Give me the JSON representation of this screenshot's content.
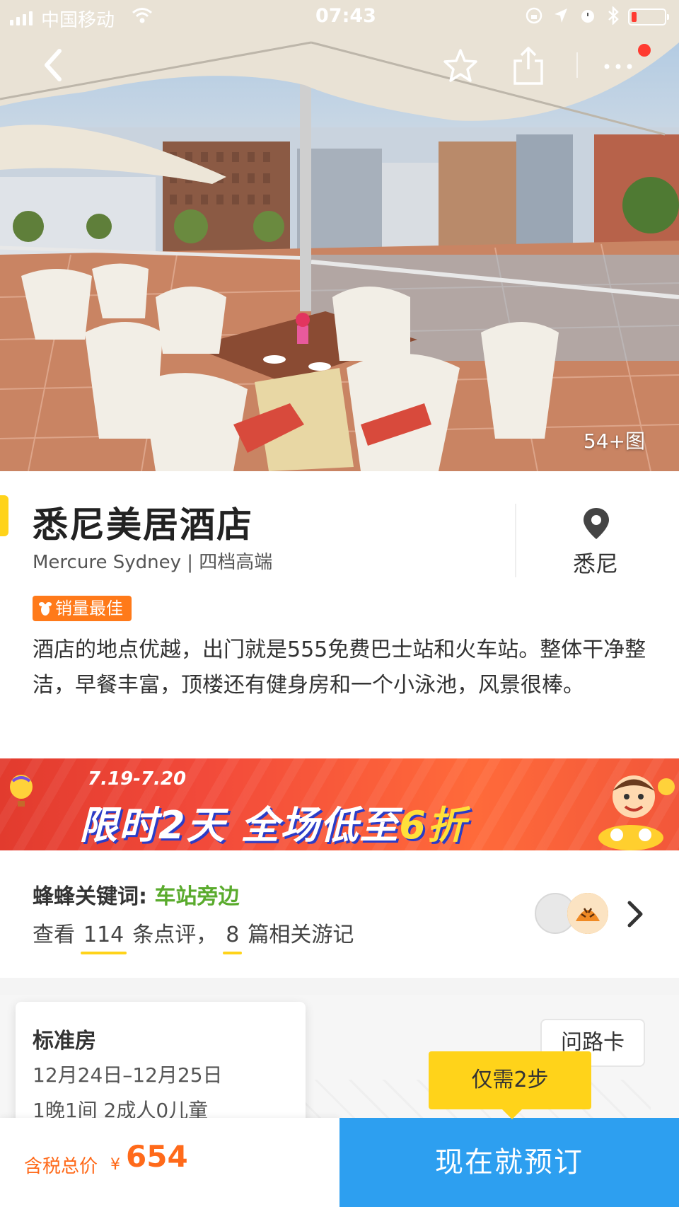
{
  "status_bar": {
    "carrier": "中国移动",
    "time": "07:43"
  },
  "nav": {
    "back_icon": "chevron-left-icon",
    "favorite_icon": "star-icon",
    "share_icon": "share-icon",
    "more_icon": "more-icon",
    "notification_dot_color": "#ff3b30"
  },
  "gallery": {
    "photo_count": "54+图"
  },
  "hotel": {
    "name": "悉尼美居酒店",
    "subtitle": "Mercure Sydney | 四档高端",
    "location": "悉尼",
    "badge": "销量最佳",
    "review": "酒店的地点优越，出门就是555免费巴士站和火车站。整体干净整洁，早餐丰富，顶楼还有健身房和一个小泳池，风景很棒。"
  },
  "promo": {
    "dates": "7.19-7.20",
    "headline_a": "限时2天 全场低至",
    "headline_b": "6折"
  },
  "keywords": {
    "label": "蜂蜂关键词:",
    "value": "车站旁边",
    "view": "查看",
    "review_count": "114",
    "reviews_suffix": "条点评，",
    "travelogue_count": "8",
    "travelogue_suffix": "篇相关游记"
  },
  "room": {
    "type": "标准房",
    "dates": "12月24日–12月25日",
    "guests": "1晚1间 2成人0儿童"
  },
  "route_card": "问路卡",
  "tooltip": "仅需2步",
  "bottom": {
    "price_label": "含税总价",
    "currency": "¥",
    "price": "654",
    "book_label": "现在就预订"
  },
  "colors": {
    "accent_yellow": "#ffd31a",
    "price_orange": "#ff6a1a",
    "book_blue": "#2d9ff0",
    "keyword_green": "#5aab2d"
  }
}
